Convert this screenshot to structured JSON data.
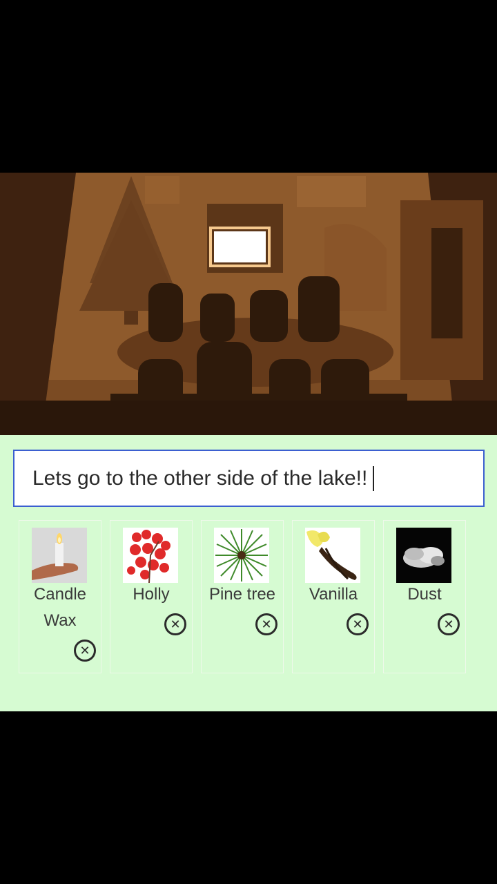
{
  "message_input": {
    "value": "Lets go to the other side of the lake!!"
  },
  "scent_items": [
    {
      "label": "Candle\nWax",
      "image": "candle-wax-image",
      "remove_icon": "close-circle-icon"
    },
    {
      "label": "Holly",
      "image": "holly-berries-image",
      "remove_icon": "close-circle-icon"
    },
    {
      "label": "Pine tree",
      "image": "pine-needles-image",
      "remove_icon": "close-circle-icon"
    },
    {
      "label": "Vanilla",
      "image": "vanilla-flower-image",
      "remove_icon": "close-circle-icon"
    },
    {
      "label": "Dust",
      "image": "dust-cloud-image",
      "remove_icon": "close-circle-icon"
    }
  ],
  "colors": {
    "panel_background": "#d6fbd2",
    "input_border": "#3b5fd0",
    "scene_tone": "#7a4a22"
  }
}
